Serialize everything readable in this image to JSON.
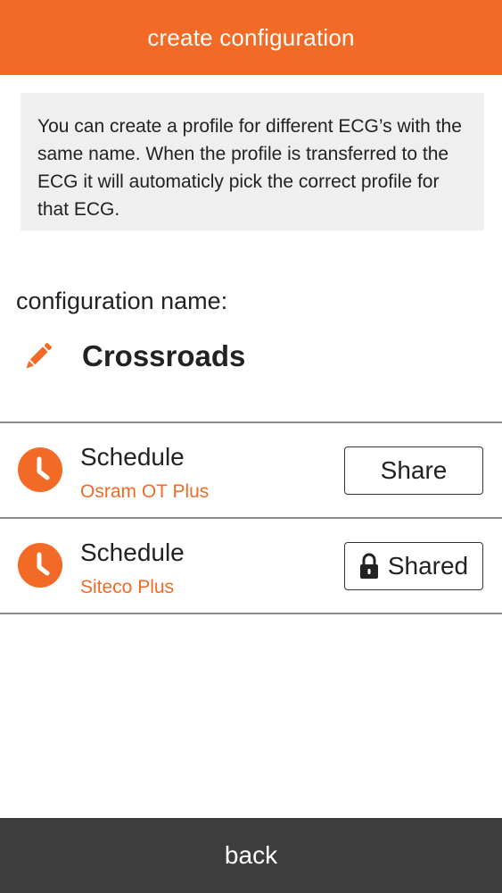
{
  "header": {
    "title": "create configuration"
  },
  "info": {
    "text": "You can create a profile for different ECG’s with the same name. When the profile is transferred to the ECG it will automaticly pick the correct profile for that ECG."
  },
  "config": {
    "label": "configuration name:",
    "name": "Crossroads",
    "edit_icon": "pencil-icon"
  },
  "schedules": [
    {
      "title": "Schedule",
      "subtitle": "Osram OT Plus",
      "button_label": "Share",
      "icon": "clock-icon",
      "locked": false
    },
    {
      "title": "Schedule",
      "subtitle": "Siteco Plus",
      "button_label": "Shared",
      "icon": "clock-icon",
      "locked": true
    }
  ],
  "footer": {
    "back_label": "back"
  },
  "colors": {
    "accent": "#f26a25",
    "footer_bg": "#3d3d3d",
    "info_bg": "#efefef"
  }
}
